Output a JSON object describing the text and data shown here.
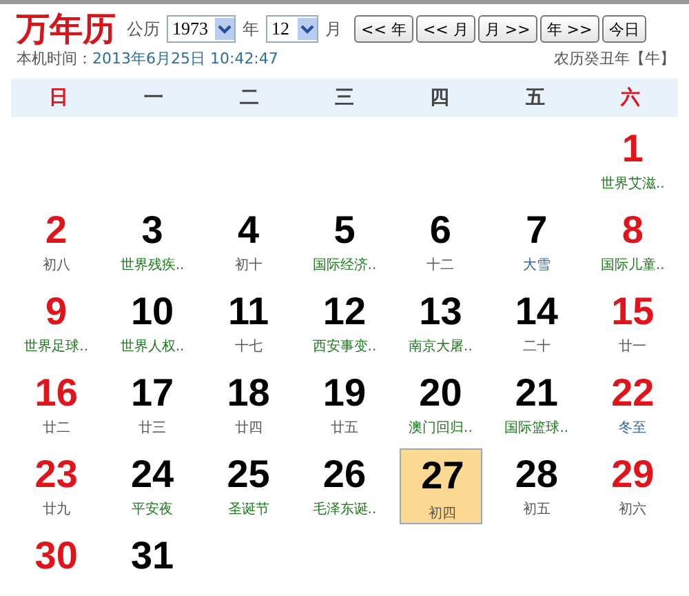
{
  "logo": "万年历",
  "calendar_label": "公历",
  "year_select": {
    "value": "1973"
  },
  "year_unit": "年",
  "month_select": {
    "value": "12"
  },
  "month_unit": "月",
  "nav_buttons": [
    "<< 年",
    "<< 月",
    "月 >>",
    "年 >>",
    "今日"
  ],
  "local_time_label": "本机时间：",
  "local_time": "2013年6月25日 10:42:47",
  "lunar_year": "农历癸丑年【牛】",
  "weekdays": [
    {
      "label": "日",
      "weekend": true
    },
    {
      "label": "一",
      "weekend": false
    },
    {
      "label": "二",
      "weekend": false
    },
    {
      "label": "三",
      "weekend": false
    },
    {
      "label": "四",
      "weekend": false
    },
    {
      "label": "五",
      "weekend": false
    },
    {
      "label": "六",
      "weekend": true
    }
  ],
  "weeks": [
    {
      "days": [
        {
          "day": "1",
          "weekend": true,
          "selected": false,
          "note": "世界艾滋..",
          "kind": "festival"
        }
      ]
    },
    {
      "days": [
        {
          "day": "2",
          "weekend": true,
          "selected": false,
          "note": "初八",
          "kind": "lunar"
        },
        {
          "day": "3",
          "weekend": false,
          "selected": false,
          "note": "世界残疾..",
          "kind": "festival"
        },
        {
          "day": "4",
          "weekend": false,
          "selected": false,
          "note": "初十",
          "kind": "lunar"
        },
        {
          "day": "5",
          "weekend": false,
          "selected": false,
          "note": "国际经济..",
          "kind": "festival"
        },
        {
          "day": "6",
          "weekend": false,
          "selected": false,
          "note": "十二",
          "kind": "lunar"
        },
        {
          "day": "7",
          "weekend": false,
          "selected": false,
          "note": "大雪",
          "kind": "term"
        },
        {
          "day": "8",
          "weekend": true,
          "selected": false,
          "note": "国际儿童..",
          "kind": "festival"
        }
      ]
    },
    {
      "days": [
        {
          "day": "9",
          "weekend": true,
          "selected": false,
          "note": "世界足球..",
          "kind": "festival"
        },
        {
          "day": "10",
          "weekend": false,
          "selected": false,
          "note": "世界人权..",
          "kind": "festival"
        },
        {
          "day": "11",
          "weekend": false,
          "selected": false,
          "note": "十七",
          "kind": "lunar"
        },
        {
          "day": "12",
          "weekend": false,
          "selected": false,
          "note": "西安事变..",
          "kind": "festival"
        },
        {
          "day": "13",
          "weekend": false,
          "selected": false,
          "note": "南京大屠..",
          "kind": "festival"
        },
        {
          "day": "14",
          "weekend": false,
          "selected": false,
          "note": "二十",
          "kind": "lunar"
        },
        {
          "day": "15",
          "weekend": true,
          "selected": false,
          "note": "廿一",
          "kind": "lunar"
        }
      ]
    },
    {
      "days": [
        {
          "day": "16",
          "weekend": true,
          "selected": false,
          "note": "廿二",
          "kind": "lunar"
        },
        {
          "day": "17",
          "weekend": false,
          "selected": false,
          "note": "廿三",
          "kind": "lunar"
        },
        {
          "day": "18",
          "weekend": false,
          "selected": false,
          "note": "廿四",
          "kind": "lunar"
        },
        {
          "day": "19",
          "weekend": false,
          "selected": false,
          "note": "廿五",
          "kind": "lunar"
        },
        {
          "day": "20",
          "weekend": false,
          "selected": false,
          "note": "澳门回归..",
          "kind": "festival"
        },
        {
          "day": "21",
          "weekend": false,
          "selected": false,
          "note": "国际篮球..",
          "kind": "festival"
        },
        {
          "day": "22",
          "weekend": true,
          "selected": false,
          "note": "冬至",
          "kind": "term"
        }
      ]
    },
    {
      "days": [
        {
          "day": "23",
          "weekend": true,
          "selected": false,
          "note": "廿九",
          "kind": "lunar"
        },
        {
          "day": "24",
          "weekend": false,
          "selected": false,
          "note": "平安夜",
          "kind": "festival"
        },
        {
          "day": "25",
          "weekend": false,
          "selected": false,
          "note": "圣诞节",
          "kind": "festival"
        },
        {
          "day": "26",
          "weekend": false,
          "selected": false,
          "note": "毛泽东诞..",
          "kind": "festival"
        },
        {
          "day": "27",
          "weekend": false,
          "selected": true,
          "note": "初四",
          "kind": "lunar"
        },
        {
          "day": "28",
          "weekend": false,
          "selected": false,
          "note": "初五",
          "kind": "lunar"
        },
        {
          "day": "29",
          "weekend": true,
          "selected": false,
          "note": "初六",
          "kind": "lunar"
        }
      ]
    },
    {
      "days": [
        {
          "day": "30",
          "weekend": true,
          "selected": false
        },
        {
          "day": "31",
          "weekend": false,
          "selected": false
        }
      ]
    }
  ]
}
